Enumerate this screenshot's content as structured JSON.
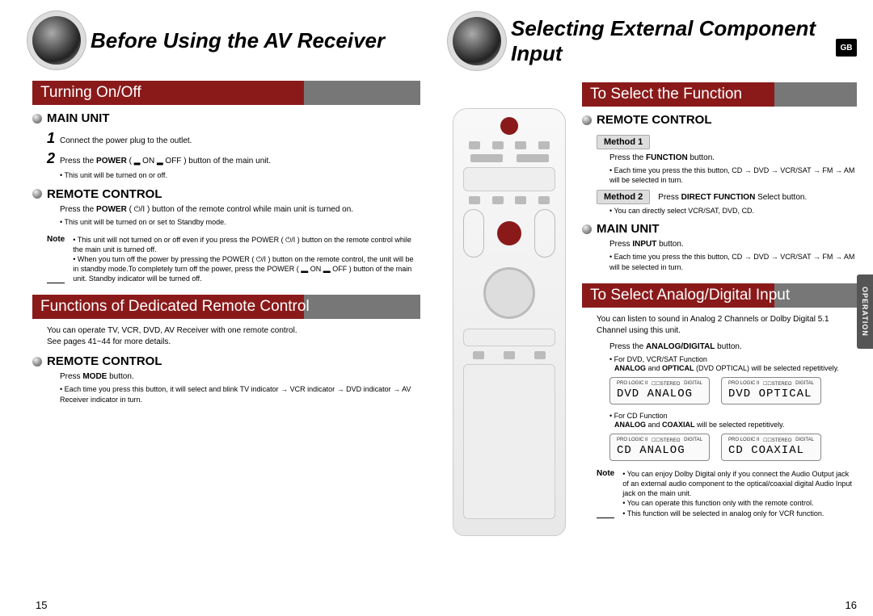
{
  "left": {
    "title": "Before Using the AV Receiver",
    "sec1": "Turning On/Off",
    "main_unit": "MAIN UNIT",
    "step1": "Connect the power plug to the outlet.",
    "step2a": "Press the ",
    "step2b": "POWER",
    "step2c": " ( ▂ ON ▂ OFF ) button of the main unit.",
    "step2_tip": "This unit will be turned on or off.",
    "remote_control": "REMOTE CONTROL",
    "rc_body_a": "Press the ",
    "rc_body_b": "POWER",
    "rc_body_c": " ( ⏻/I ) button of the remote control while main unit is turned on.",
    "rc_tip": "This unit will be turned on or set to Standby mode.",
    "note_label": "Note",
    "note1": "This unit will not turned on or off even if you press the POWER ( ⏻/I ) button on the remote control while the main unit is turned off.",
    "note2": "When you turn off the power by pressing the POWER ( ⏻/I ) button on the remote control, the unit will be in standby mode.To completely turn off the power, press the POWER ( ▂ ON ▂ OFF ) button of the main unit. Standby indicator will be turned off.",
    "sec2": "Functions of Dedicated Remote Control",
    "sec2_body": "You can operate TV, VCR, DVD, AV Receiver with one remote control.\nSee pages 41~44 for more details.",
    "rc2_body_a": "Press ",
    "rc2_body_b": "MODE",
    "rc2_body_c": " button.",
    "rc2_tip": "Each time you press this button, it will select and blink TV indicator → VCR indicator → DVD indicator → AV Receiver indicator in turn.",
    "page": "15"
  },
  "right": {
    "title": "Selecting External Component Input",
    "gb": "GB",
    "sec1": "To Select the Function",
    "remote_control": "REMOTE CONTROL",
    "method1": "Method 1",
    "m1_a": "Press the ",
    "m1_b": "FUNCTION",
    "m1_c": " button.",
    "m1_tip": "Each time you press the this button, CD → DVD → VCR/SAT → FM → AM will be selected in turn.",
    "method2": "Method 2",
    "m2_a": "Press ",
    "m2_b": "DIRECT FUNCTION",
    "m2_c": " Select button.",
    "m2_tip": "You can directly select VCR/SAT, DVD, CD.",
    "main_unit": "MAIN UNIT",
    "mu_a": "Press ",
    "mu_b": "INPUT",
    "mu_c": " button.",
    "mu_tip": "Each time you press the this button, CD → DVD → VCR/SAT → FM → AM will be selected in turn.",
    "sec2": "To Select Analog/Digital Input",
    "sec2_body": "You can listen to sound in Analog 2 Channels or Dolby Digital 5.1 Channel using this unit.",
    "ad_a": "Press the ",
    "ad_b": "ANALOG/DIGITAL",
    "ad_c": " button.",
    "tip_dvd_hdr": "For DVD, VCR/SAT Function",
    "tip_dvd_a": "ANALOG",
    "tip_dvd_b": " and ",
    "tip_dvd_c": "OPTICAL",
    "tip_dvd_d": " (DVD OPTICAL) will be selected repetitively.",
    "lcd1": "DVD ANALOG",
    "lcd2": "DVD OPTICAL",
    "tip_cd_hdr": "For CD Function",
    "tip_cd_a": "ANALOG",
    "tip_cd_b": " and ",
    "tip_cd_c": "COAXIAL",
    "tip_cd_d": " will be selected repetitively.",
    "lcd3": "CD ANALOG",
    "lcd4": "CD COAXIAL",
    "note_label": "Note",
    "note1": "You can enjoy Dolby Digital only if you connect the Audio Output jack of an external audio component to the optical/coaxial digital Audio Input jack on the main unit.",
    "note2": "You can operate this function only with the  remote control.",
    "note3": "This function will be selected in analog only for VCR function.",
    "side_tab": "OPERATION",
    "page": "16",
    "lcd_top_left": "PRO LOGIC II",
    "lcd_top_mid": "☐☐STEREO",
    "lcd_top_right": "DIGITAL"
  }
}
